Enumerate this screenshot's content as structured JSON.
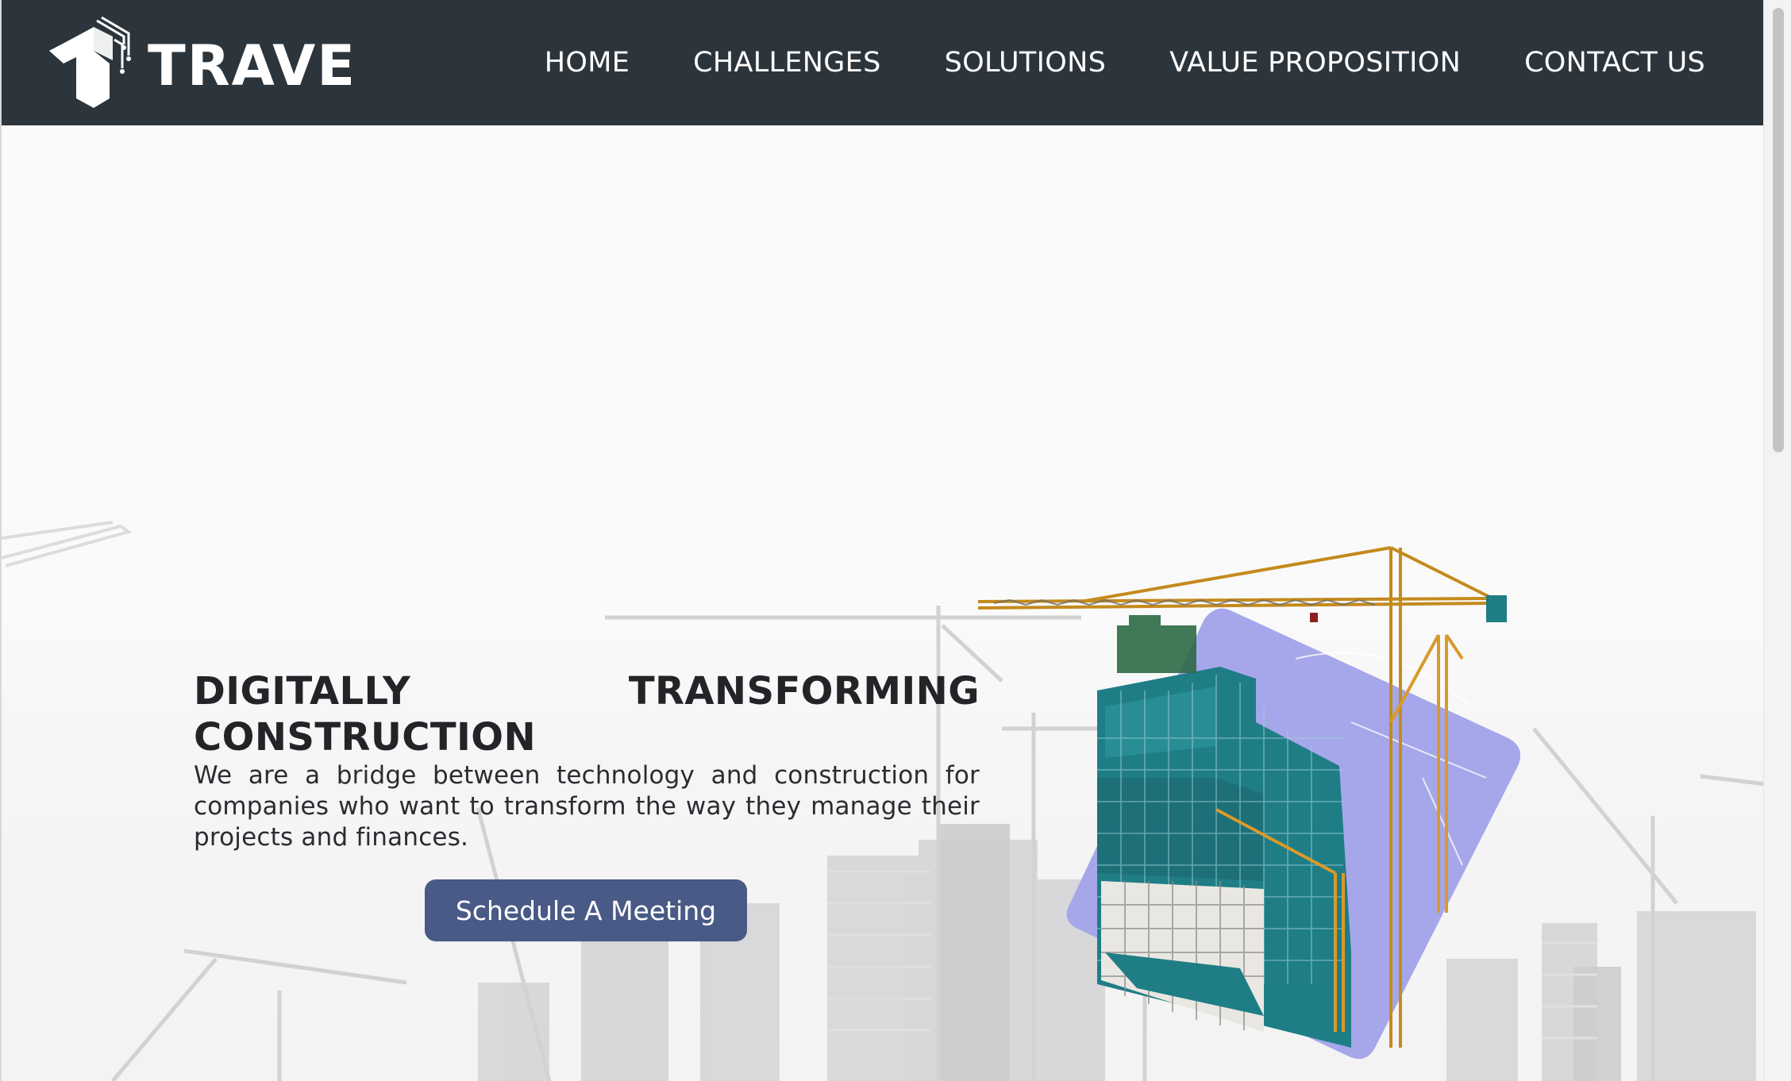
{
  "brand": {
    "name": "TRAVE"
  },
  "nav": {
    "items": [
      {
        "label": "HOME"
      },
      {
        "label": "CHALLENGES"
      },
      {
        "label": "SOLUTIONS"
      },
      {
        "label": "VALUE PROPOSITION"
      },
      {
        "label": "CONTACT US"
      }
    ]
  },
  "hero": {
    "title": "DIGITALLY TRANSFORMING CONSTRUCTION",
    "description": "We are a bridge between technology and construction for companies who want to transform the way they manage their projects and finances.",
    "cta_label": "Schedule A Meeting"
  },
  "icons": {
    "logo": "trave-logo-icon",
    "illustration": "construction-building-crane-illustration",
    "background": "city-cranes-silhouette"
  },
  "colors": {
    "navbar": "#2d353c",
    "cta": "#485a85",
    "accent_diamond": "#a6a7ea",
    "title_text": "#222428",
    "page_background": "#fafafa"
  }
}
